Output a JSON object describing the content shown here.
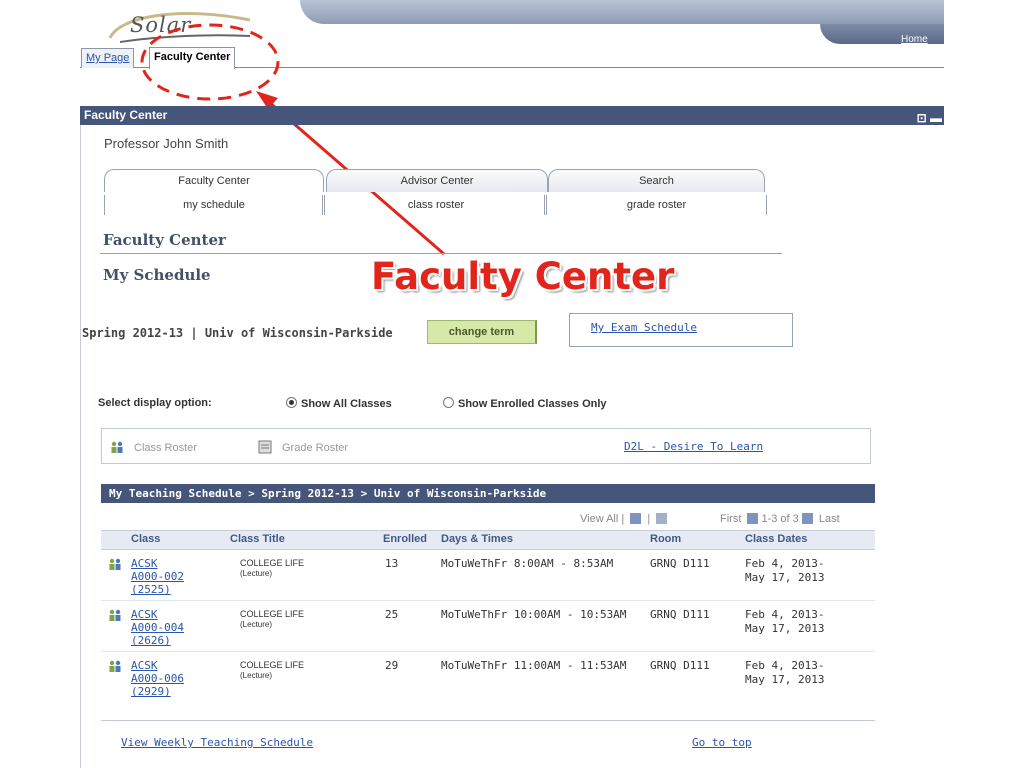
{
  "brand": {
    "logo_text": "Solar"
  },
  "top_nav": {
    "home": "Home"
  },
  "page_tabs": [
    {
      "label": "My Page"
    },
    {
      "label": "Faculty Center"
    }
  ],
  "header": {
    "title": "Faculty Center"
  },
  "user": {
    "name": "Professor John Smith"
  },
  "section_tabs": [
    {
      "label": "Faculty Center",
      "sub": "my schedule"
    },
    {
      "label": "Advisor Center",
      "sub": "class roster"
    },
    {
      "label": "Search",
      "sub": "grade roster"
    }
  ],
  "headings": {
    "center": "Faculty Center",
    "schedule": "My Schedule"
  },
  "annotation": {
    "label": "Faculty Center",
    "color": "#e1251b"
  },
  "term": {
    "text": "Spring 2012-13 | Univ of Wisconsin-Parkside",
    "change_button": "change term",
    "exam_link": "My Exam Schedule"
  },
  "display": {
    "label": "Select display option:",
    "options": [
      {
        "label": "Show All Classes",
        "selected": true
      },
      {
        "label": "Show Enrolled Classes Only",
        "selected": false
      }
    ]
  },
  "tools": {
    "class_roster": "Class Roster",
    "grade_roster": "Grade Roster",
    "d2l": "D2L - Desire To Learn"
  },
  "schedule": {
    "title": "My Teaching Schedule > Spring 2012-13 > Univ of Wisconsin-Parkside",
    "view_all": "View All",
    "pager": {
      "first": "First",
      "range": "1-3 of 3",
      "last": "Last"
    },
    "columns": [
      "Class",
      "Class Title",
      "Enrolled",
      "Days & Times",
      "Room",
      "Class Dates"
    ],
    "rows": [
      {
        "class_line1": "ACSK",
        "class_line2": "A000-002",
        "class_line3": "(2525)",
        "title": "COLLEGE LIFE",
        "type": "(Lecture)",
        "enrolled": "13",
        "days_times": "MoTuWeThFr 8:00AM - 8:53AM",
        "room": "GRNQ D111",
        "dates_line1": "Feb 4, 2013-",
        "dates_line2": "May 17, 2013"
      },
      {
        "class_line1": "ACSK",
        "class_line2": "A000-004",
        "class_line3": "(2626)",
        "title": "COLLEGE LIFE",
        "type": "(Lecture)",
        "enrolled": "25",
        "days_times": "MoTuWeThFr 10:00AM - 10:53AM",
        "room": "GRNQ D111",
        "dates_line1": "Feb 4, 2013-",
        "dates_line2": "May 17, 2013"
      },
      {
        "class_line1": "ACSK",
        "class_line2": "A000-006",
        "class_line3": "(2929)",
        "title": "COLLEGE LIFE",
        "type": "(Lecture)",
        "enrolled": "29",
        "days_times": "MoTuWeThFr 11:00AM - 11:53AM",
        "room": "GRNQ D111",
        "dates_line1": "Feb 4, 2013-",
        "dates_line2": "May 17, 2013"
      }
    ]
  },
  "footer_links": {
    "weekly": "View Weekly Teaching Schedule",
    "top": "Go to top"
  }
}
